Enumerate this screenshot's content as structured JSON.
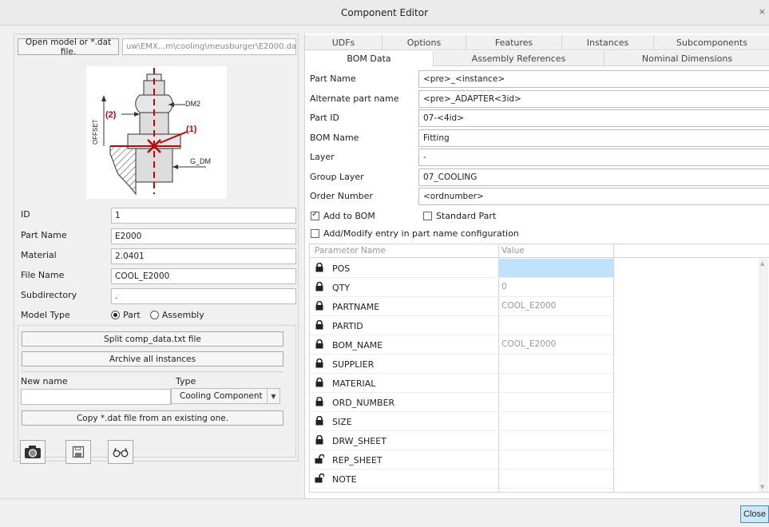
{
  "window": {
    "title": "Component Editor"
  },
  "left": {
    "open_button": "Open model or *.dat file.",
    "path": "uw\\EMX...m\\cooling\\meusburger\\E2000.dat",
    "diagram": {
      "label_1": "(1)",
      "label_2": "(2)",
      "dm2": "DM2",
      "g_dm": "G_DM",
      "offset": "OFFSET"
    },
    "fields": [
      {
        "label": "ID",
        "value": "1"
      },
      {
        "label": "Part Name",
        "value": "E2000"
      },
      {
        "label": "Material",
        "value": "2.0401"
      },
      {
        "label": "File Name",
        "value": "COOL_E2000"
      },
      {
        "label": "Subdirectory",
        "value": "."
      }
    ],
    "model_type": {
      "label": "Model Type",
      "option_part": "Part",
      "option_assembly": "Assembly",
      "selected": "Part"
    },
    "split_button": "Split comp_data.txt file",
    "archive_button": "Archive all instances",
    "new_name_label": "New name",
    "new_name_value": "",
    "type_label": "Type",
    "type_value": "Cooling Component",
    "copy_button": "Copy *.dat file from an existing one.",
    "icons": [
      "camera-icon",
      "save-icon",
      "glasses-icon"
    ]
  },
  "tabs": {
    "row1": [
      "UDFs",
      "Options",
      "Features",
      "Instances",
      "Subcomponents"
    ],
    "row2": [
      "BOM Data",
      "Assembly References",
      "Nominal Dimensions"
    ],
    "active": "BOM Data"
  },
  "bom": {
    "fields": [
      {
        "label": "Part Name",
        "value": "<pre>_<instance>"
      },
      {
        "label": "Alternate part name",
        "value": "<pre>_ADAPTER<3id>"
      },
      {
        "label": "Part ID",
        "value": "07-<4id>"
      },
      {
        "label": "BOM Name",
        "value": "Fitting"
      },
      {
        "label": "Layer",
        "value": "-"
      },
      {
        "label": "Group Layer",
        "value": "07_COOLING"
      },
      {
        "label": "Order Number",
        "value": "<ordnumber>"
      }
    ],
    "add_to_bom": "Add to BOM",
    "standard_part": "Standard Part",
    "add_modify": "Add/Modify entry in part name configuration"
  },
  "params": {
    "headers": [
      "Parameter Name",
      "Value"
    ],
    "rows": [
      {
        "name": "POS",
        "value": "",
        "locked": true
      },
      {
        "name": "QTY",
        "value": "0",
        "locked": true
      },
      {
        "name": "PARTNAME",
        "value": "COOL_E2000",
        "locked": true
      },
      {
        "name": "PARTID",
        "value": "",
        "locked": true
      },
      {
        "name": "BOM_NAME",
        "value": "COOL_E2000",
        "locked": true
      },
      {
        "name": "SUPPLIER",
        "value": "",
        "locked": true
      },
      {
        "name": "MATERIAL",
        "value": "",
        "locked": true
      },
      {
        "name": "ORD_NUMBER",
        "value": "",
        "locked": true
      },
      {
        "name": "SIZE",
        "value": "",
        "locked": true
      },
      {
        "name": "DRW_SHEET",
        "value": "",
        "locked": true
      },
      {
        "name": "REP_SHEET",
        "value": "",
        "locked": false
      },
      {
        "name": "NOTE",
        "value": "",
        "locked": false
      }
    ]
  },
  "footer": {
    "close_button": "Close"
  }
}
